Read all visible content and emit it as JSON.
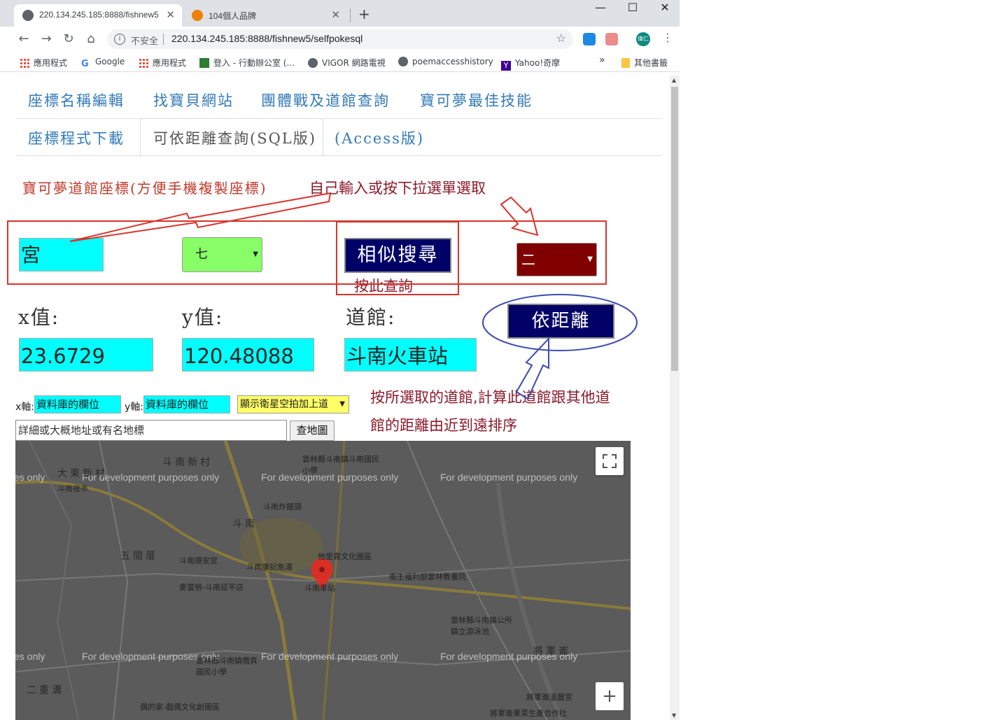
{
  "browser": {
    "tabs": [
      {
        "title": "220.134.245.185:8888/fishnew5",
        "close": "✕"
      },
      {
        "title": "104個人品牌",
        "close": "✕"
      }
    ],
    "new_tab": "+",
    "window_controls": {
      "minimize": "—",
      "maximize": "☐",
      "close": "✕"
    },
    "nav": {
      "back": "←",
      "forward": "→",
      "reload": "↻",
      "home": "⌂"
    },
    "address": {
      "security_label": "不安全",
      "url": "220.134.245.185:8888/fishnew5/selfpokesql",
      "info": "i",
      "star": "☆"
    },
    "profile_label": "偉仁",
    "menu": "⋮",
    "bookmarks": [
      {
        "label": "應用程式",
        "icon": "apps-grid-icon"
      },
      {
        "label": "Google",
        "icon": "google-icon"
      },
      {
        "label": "應用程式",
        "icon": "apps-grid-icon"
      },
      {
        "label": "登入 - 行動辦公室 (...",
        "icon": "office-icon"
      },
      {
        "label": "VIGOR 網路電視",
        "icon": "globe-icon"
      },
      {
        "label": "poemaccesshistory",
        "icon": "globe-icon"
      },
      {
        "label": "Yahoo!奇摩",
        "icon": "yahoo-icon"
      }
    ],
    "bookmarks_overflow": "»",
    "other_bookmarks": "其他書籤"
  },
  "nav": {
    "row1": [
      "座標名稱編輯",
      "找寶貝網站",
      "團體戰及道館查詢",
      "寶可夢最佳技能"
    ],
    "row2": [
      "座標程式下載",
      "可依距離查詢(SQL版)",
      "(Access版)"
    ]
  },
  "annotations": {
    "gym_coords": "寶可夢道館座標(方便手機複製座標)",
    "input_hint": "自己輸入或按下拉選單選取",
    "search_hint": "按此查詢",
    "distance_hint_line1": "按所選取的道館,計算此道館跟其他道",
    "distance_hint_line2": "館的距離由近到遠排序"
  },
  "search": {
    "keyword_value": "宮",
    "select1_value": "七",
    "button_label": "相似搜尋",
    "select2_value": "二"
  },
  "coords": {
    "x_label": "x值:",
    "y_label": "y值:",
    "gym_label": "道館:",
    "x_value": "23.6729",
    "y_value": "120.48088",
    "gym_value": "斗南火車站",
    "distance_button": "依距離"
  },
  "axes": {
    "x_label": "x軸:",
    "x_value": "資料庫的欄位",
    "y_label": "y軸:",
    "y_value": "資料庫的欄位",
    "display_select": "顯示衛星空拍加上道"
  },
  "address_search": {
    "value": "詳細或大概地址或有名地標",
    "button": "查地圖"
  },
  "map": {
    "dev_watermark": "For development purposes only",
    "places": [
      "斗南新村",
      "大東新村",
      "斗南夜市",
      "雲林縣斗南鎮斗南國民小學",
      "斗南炸饅頭",
      "斗南",
      "五間厝",
      "斗南順安宮",
      "斗南康記魚湯",
      "他里霧文化園區",
      "衛生福利部雲林教養院",
      "麥當勞-斗南延平店",
      "斗南車站",
      "雲林縣斗南鎮公所鎮立游泳池",
      "雲林縣斗南鎮僑真國民小學",
      "二重溝",
      "偶的家-戲偶文化創園區",
      "將軍崙溫曆宮",
      "將軍崙果菜生產合作社",
      "將軍崙"
    ],
    "zoom_in": "+"
  },
  "colors": {
    "accent_link": "#337ab7",
    "annotation_red": "#c0392b",
    "annotation_dark": "#8b1a2b",
    "input_cyan": "#00ffff",
    "select_green": "#88ff66",
    "select_maroon": "#800000",
    "button_navy": "#000066",
    "select_yellow": "#ffff66"
  }
}
